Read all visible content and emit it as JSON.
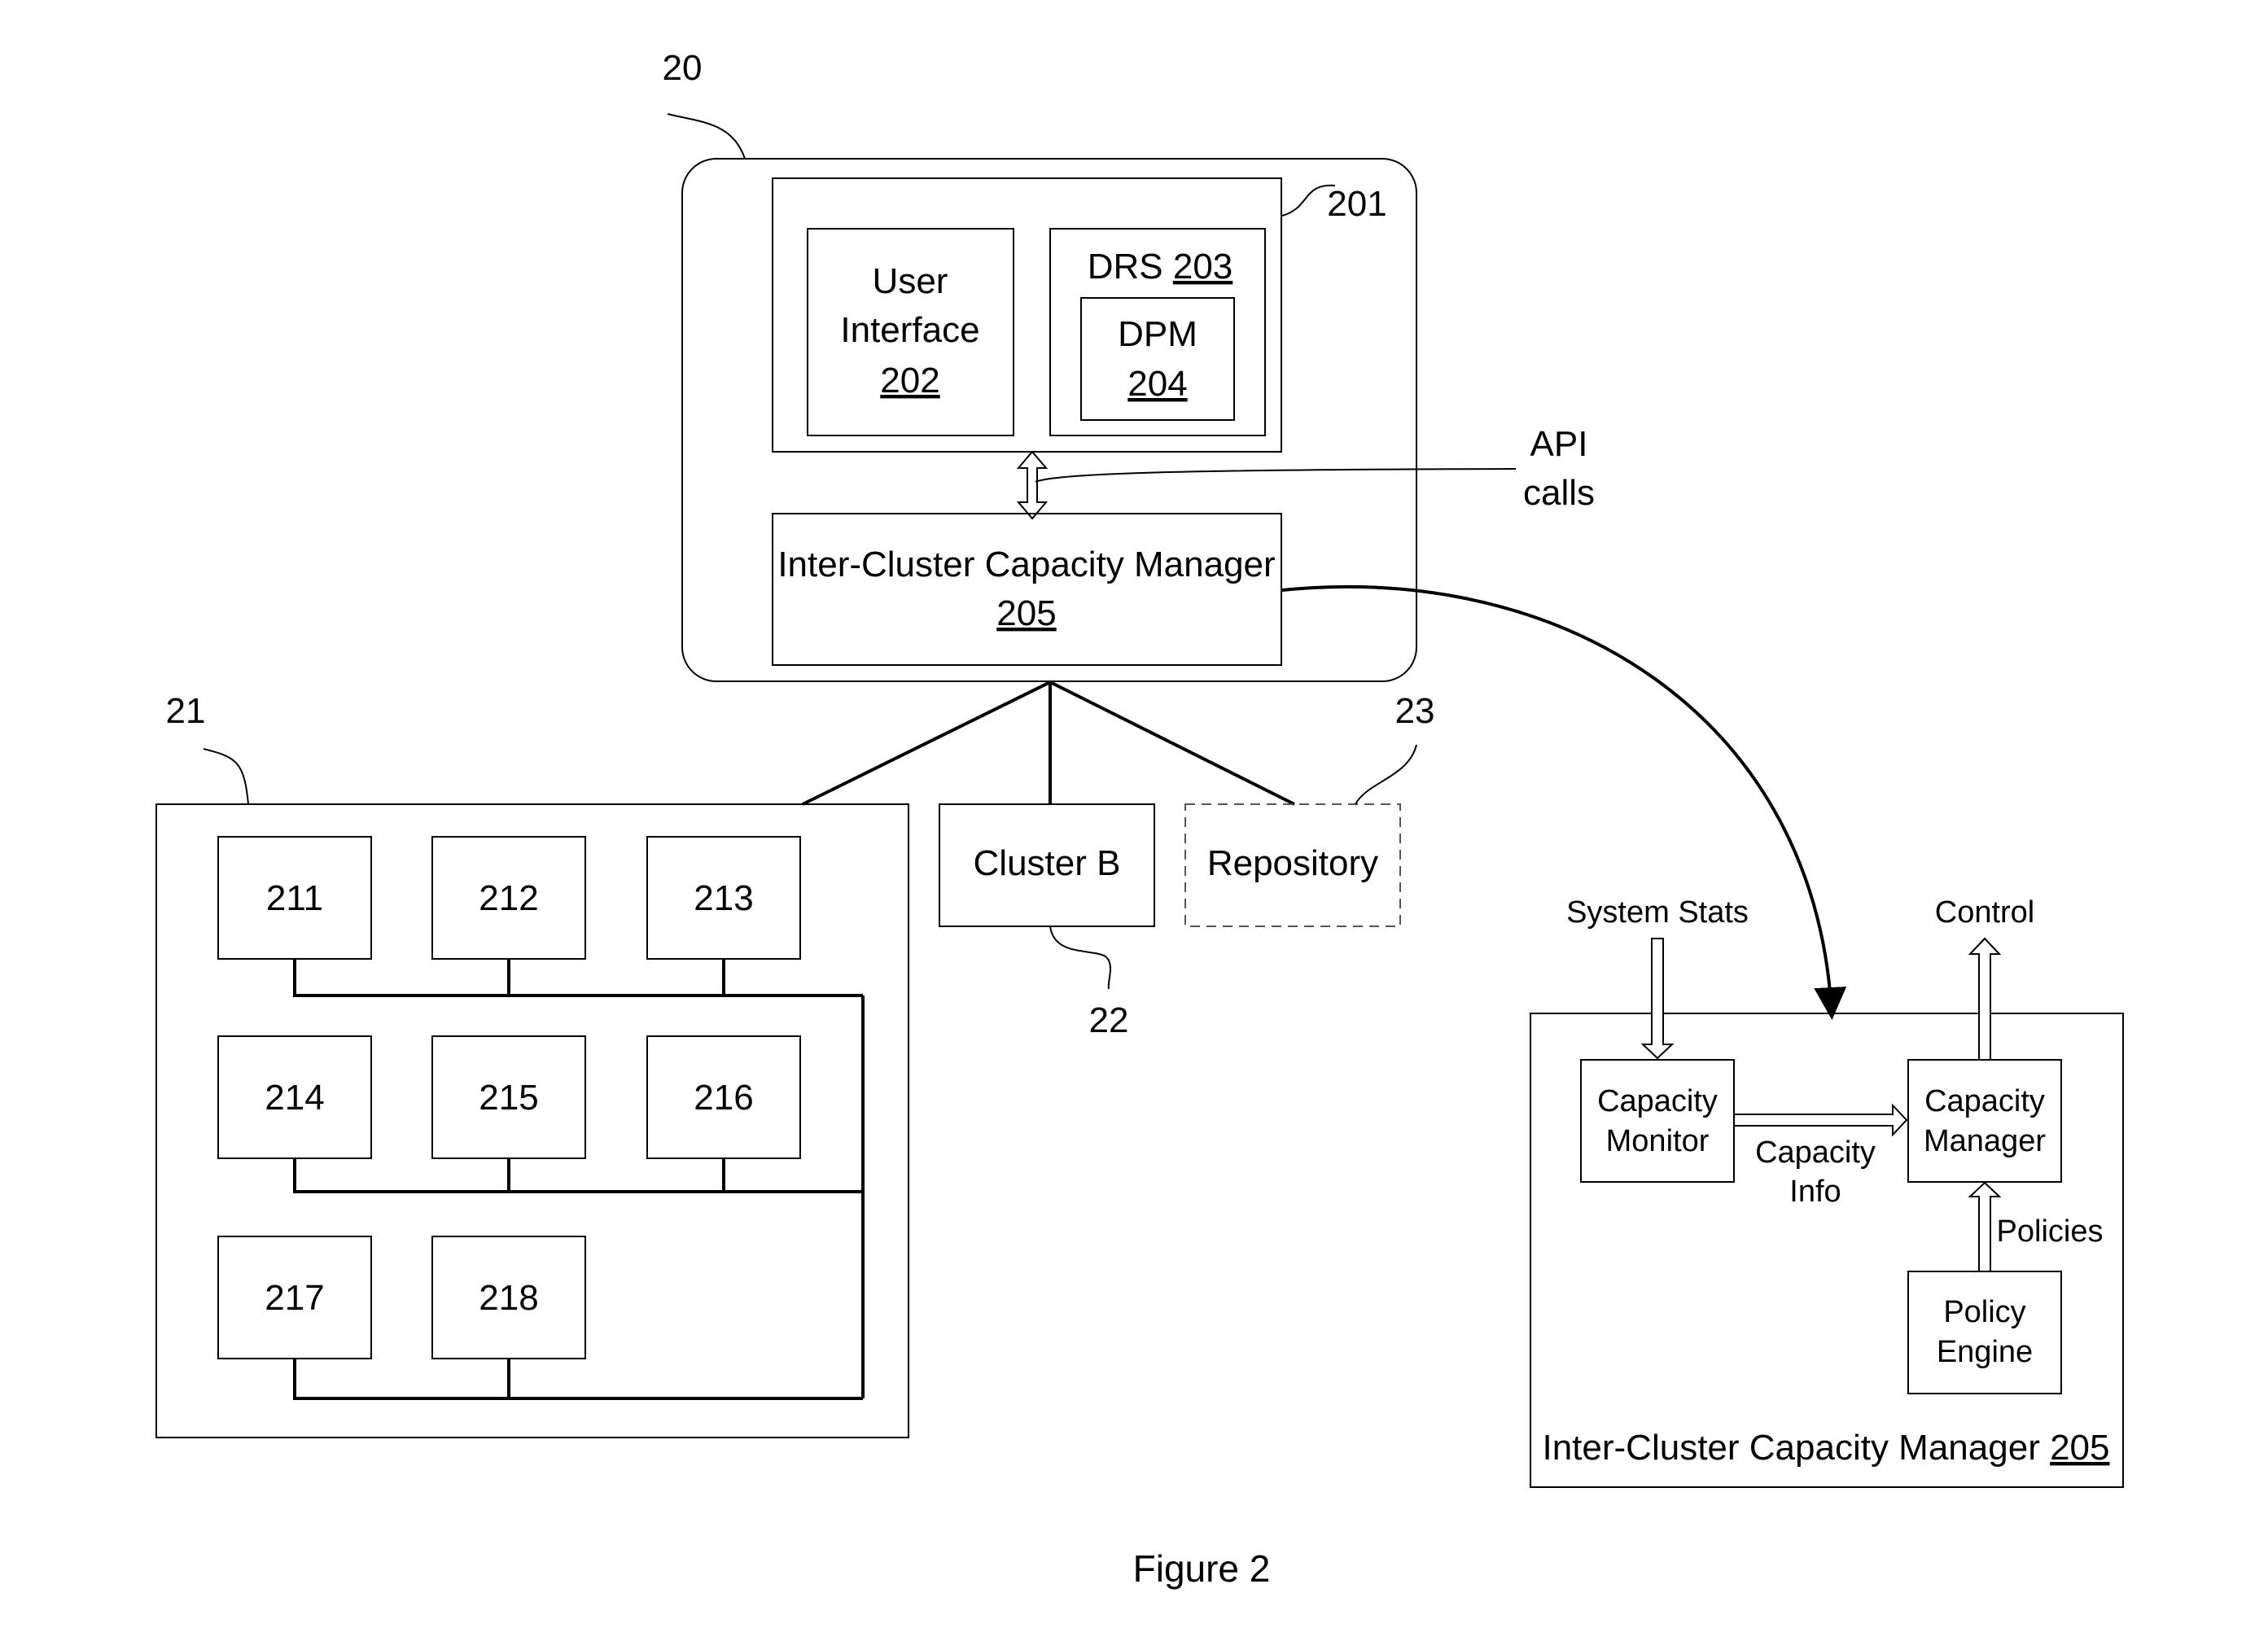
{
  "figure_caption": "Figure 2",
  "labels": {
    "ref_20": "20",
    "ref_201": "201",
    "ref_21": "21",
    "ref_22": "22",
    "ref_23": "23",
    "api_calls_line1": "API",
    "api_calls_line2": "calls"
  },
  "server_box": {
    "user_interface": {
      "line1": "User",
      "line2": "Interface",
      "ref": "202"
    },
    "drs": {
      "label": "DRS ",
      "ref": "203"
    },
    "dpm": {
      "label": "DPM",
      "ref": "204"
    },
    "icm": {
      "label": "Inter-Cluster Capacity Manager",
      "ref": "205"
    }
  },
  "cluster_a": {
    "hosts": [
      "211",
      "212",
      "213",
      "214",
      "215",
      "216",
      "217",
      "218"
    ]
  },
  "cluster_b": {
    "label": "Cluster B"
  },
  "repository": {
    "label": "Repository"
  },
  "icm_detail": {
    "title": "Inter-Cluster Capacity Manager ",
    "title_ref": "205",
    "system_stats": "System Stats",
    "control": "Control",
    "capacity_monitor": {
      "line1": "Capacity",
      "line2": "Monitor"
    },
    "capacity_manager": {
      "line1": "Capacity",
      "line2": "Manager"
    },
    "capacity_info": {
      "line1": "Capacity",
      "line2": "Info"
    },
    "policies": "Policies",
    "policy_engine": {
      "line1": "Policy",
      "line2": "Engine"
    }
  }
}
